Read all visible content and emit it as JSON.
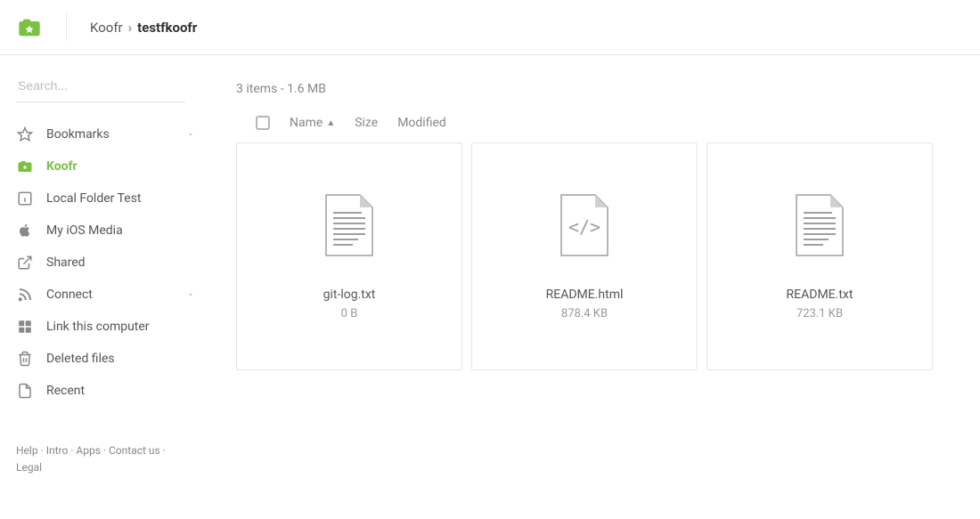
{
  "breadcrumb": {
    "root": "Koofr",
    "current": "testfkoofr"
  },
  "search": {
    "placeholder": "Search..."
  },
  "sidebar": {
    "items": [
      {
        "label": "Bookmarks",
        "icon": "star",
        "has_chevron": true,
        "active": false
      },
      {
        "label": "Koofr",
        "icon": "bag-star",
        "has_chevron": false,
        "active": true
      },
      {
        "label": "Local Folder Test",
        "icon": "info-square",
        "has_chevron": false,
        "active": false
      },
      {
        "label": "My iOS Media",
        "icon": "apple",
        "has_chevron": false,
        "active": false
      },
      {
        "label": "Shared",
        "icon": "external",
        "has_chevron": false,
        "active": false
      },
      {
        "label": "Connect",
        "icon": "rss",
        "has_chevron": true,
        "active": false
      },
      {
        "label": "Link this computer",
        "icon": "grid",
        "has_chevron": false,
        "active": false
      },
      {
        "label": "Deleted files",
        "icon": "trash",
        "has_chevron": false,
        "active": false
      },
      {
        "label": "Recent",
        "icon": "doc",
        "has_chevron": false,
        "active": false
      }
    ]
  },
  "footer": {
    "links": [
      "Help",
      "Intro",
      "Apps",
      "Contact us",
      "Legal"
    ]
  },
  "main": {
    "status": "3 items - 1.6 MB",
    "columns": {
      "name": "Name",
      "size": "Size",
      "modified": "Modified"
    },
    "files": [
      {
        "name": "git-log.txt",
        "size": "0 B",
        "kind": "text"
      },
      {
        "name": "README.html",
        "size": "878.4 KB",
        "kind": "code"
      },
      {
        "name": "README.txt",
        "size": "723.1 KB",
        "kind": "text"
      }
    ]
  }
}
